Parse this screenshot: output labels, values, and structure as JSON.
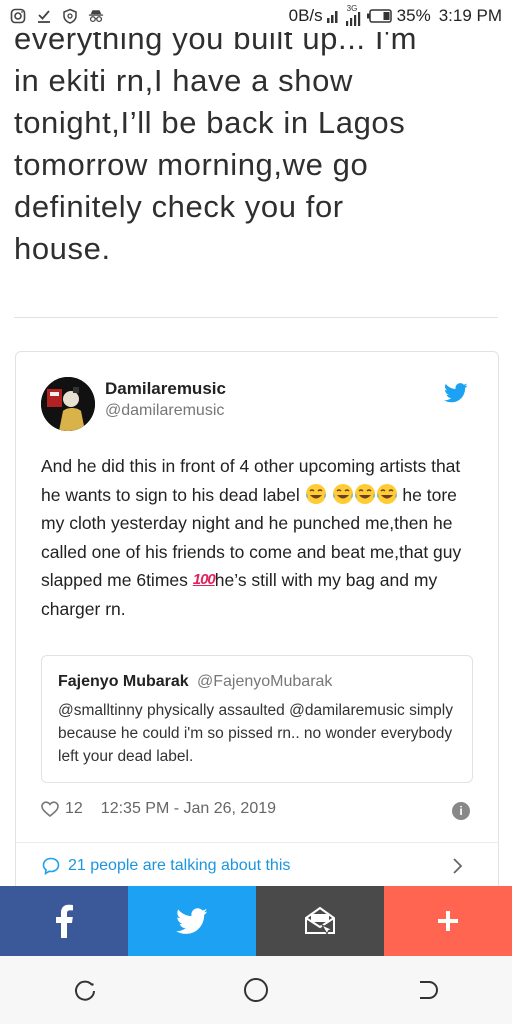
{
  "status_bar": {
    "network_speed": "0B/s",
    "network_type": "3G",
    "battery": "35%",
    "time": "3:19 PM",
    "icons": [
      "instagram-icon",
      "download-icon",
      "shield-icon",
      "incognito-icon",
      "signal-icon",
      "battery-icon"
    ]
  },
  "article": {
    "text": "everything you built up... I'm\nin ekiti rn,I have a show\ntonight,I’ll be back in Lagos\ntomorrow morning,we go\ndefinitely check you for\nhouse."
  },
  "tweet": {
    "author_name": "Damilaremusic",
    "author_handle": "@damilaremusic",
    "text_part1": "And he did this in front of 4 other upcoming artists that he wants to sign to his dead label ",
    "text_part2": " he tore my cloth yesterday night and he punched me,then he called one of his friends to come and beat me,that guy slapped me 6times ",
    "hundred_emoji": "100",
    "text_part3": "he’s still with my bag and my charger rn.",
    "quote": {
      "author_name": "Fajenyo Mubarak",
      "author_handle": "@FajenyoMubarak",
      "text": "@smalltinny physically assaulted @damilaremusic simply because he could i'm so pissed rn.. no wonder everybody left your dead label."
    },
    "likes": "12",
    "timestamp": "12:35 PM - Jan 26, 2019",
    "talking": "21 people are talking about this"
  },
  "share_bar": {
    "buttons": [
      "facebook",
      "twitter",
      "email",
      "more"
    ],
    "colors": {
      "facebook": "#3b5998",
      "twitter": "#1da1f2",
      "email": "#4a4a4a",
      "more": "#ff6550"
    }
  },
  "accent_color": "#1da1f2"
}
